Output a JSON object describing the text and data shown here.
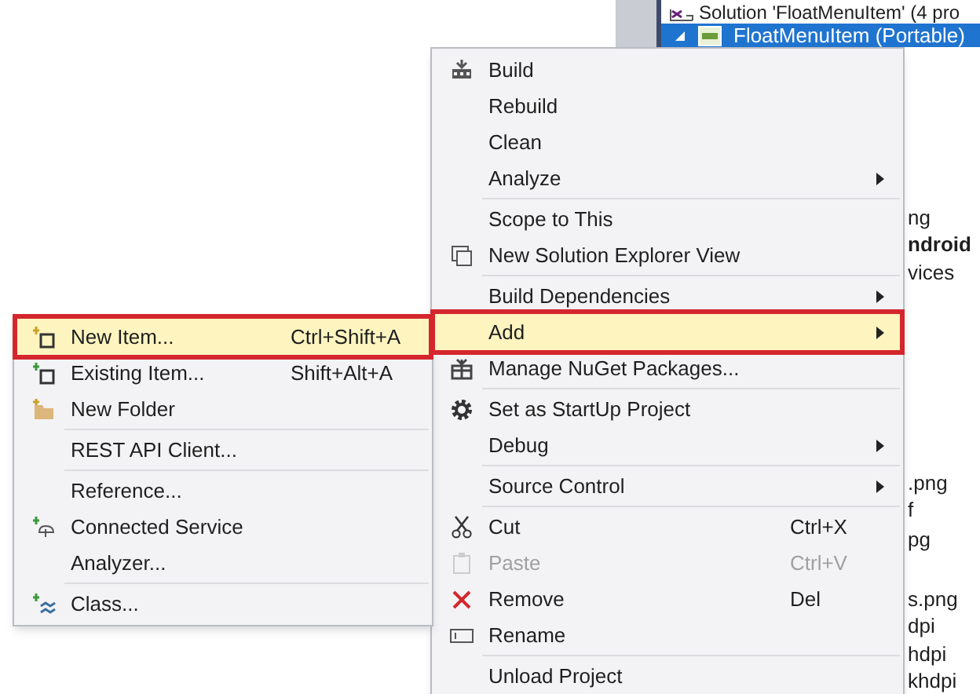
{
  "solution_explorer": {
    "rows": [
      {
        "label": "Solution 'FloatMenuItem' (4 pro",
        "selected": false
      },
      {
        "label": "FloatMenuItem (Portable)",
        "selected": true,
        "expanded": true
      }
    ],
    "fragments": [
      {
        "text": "ng",
        "bold": false
      },
      {
        "text": "ndroid",
        "bold": true
      },
      {
        "text": "vices",
        "bold": false
      },
      {
        "text": ".png",
        "bold": false
      },
      {
        "text": "f",
        "bold": false
      },
      {
        "text": "pg",
        "bold": false
      },
      {
        "text": "s.png",
        "bold": false
      },
      {
        "text": "dpi",
        "bold": false
      },
      {
        "text": "hdpi",
        "bold": false
      },
      {
        "text": "khdpi",
        "bold": false
      }
    ]
  },
  "context_menu": {
    "groups": [
      [
        {
          "label": "Build",
          "selected": false,
          "disabled": false,
          "submenu": false
        },
        {
          "label": "Rebuild",
          "selected": false,
          "disabled": false,
          "submenu": false
        },
        {
          "label": "Clean",
          "selected": false,
          "disabled": false,
          "submenu": false
        },
        {
          "label": "Analyze",
          "selected": false,
          "disabled": false,
          "submenu": true
        }
      ],
      [
        {
          "label": "Scope to This",
          "selected": false,
          "disabled": false,
          "submenu": false
        },
        {
          "label": "New Solution Explorer View",
          "selected": false,
          "disabled": false,
          "submenu": false
        }
      ],
      [
        {
          "label": "Build Dependencies",
          "selected": false,
          "disabled": false,
          "submenu": true
        },
        {
          "label": "Add",
          "selected": true,
          "disabled": false,
          "submenu": true
        },
        {
          "label": "Manage NuGet Packages...",
          "selected": false,
          "disabled": false,
          "submenu": false
        }
      ],
      [
        {
          "label": "Set as StartUp Project",
          "selected": false,
          "disabled": false,
          "submenu": false
        },
        {
          "label": "Debug",
          "selected": false,
          "disabled": false,
          "submenu": true
        }
      ],
      [
        {
          "label": "Source Control",
          "selected": false,
          "disabled": false,
          "submenu": true
        }
      ],
      [
        {
          "label": "Cut",
          "shortcut": "Ctrl+X",
          "selected": false,
          "disabled": false,
          "submenu": false
        },
        {
          "label": "Paste",
          "shortcut": "Ctrl+V",
          "selected": false,
          "disabled": true,
          "submenu": false
        },
        {
          "label": "Remove",
          "shortcut": "Del",
          "selected": false,
          "disabled": false,
          "submenu": false
        },
        {
          "label": "Rename",
          "selected": false,
          "disabled": false,
          "submenu": false
        }
      ],
      [
        {
          "label": "Unload Project",
          "selected": false,
          "disabled": false,
          "submenu": false
        }
      ]
    ]
  },
  "add_submenu": {
    "groups": [
      [
        {
          "label": "New Item...",
          "shortcut": "Ctrl+Shift+A",
          "selected": true,
          "disabled": false,
          "submenu": false
        },
        {
          "label": "Existing Item...",
          "shortcut": "Shift+Alt+A",
          "selected": false,
          "disabled": false,
          "submenu": false
        },
        {
          "label": "New Folder",
          "selected": false,
          "disabled": false,
          "submenu": false
        }
      ],
      [
        {
          "label": "REST API Client...",
          "selected": false,
          "disabled": false,
          "submenu": false
        }
      ],
      [
        {
          "label": "Reference...",
          "selected": false,
          "disabled": false,
          "submenu": false
        },
        {
          "label": "Connected Service",
          "selected": false,
          "disabled": false,
          "submenu": false
        },
        {
          "label": "Analyzer...",
          "selected": false,
          "disabled": false,
          "submenu": false
        }
      ],
      [
        {
          "label": "Class...",
          "selected": false,
          "disabled": false,
          "submenu": false
        }
      ]
    ]
  }
}
